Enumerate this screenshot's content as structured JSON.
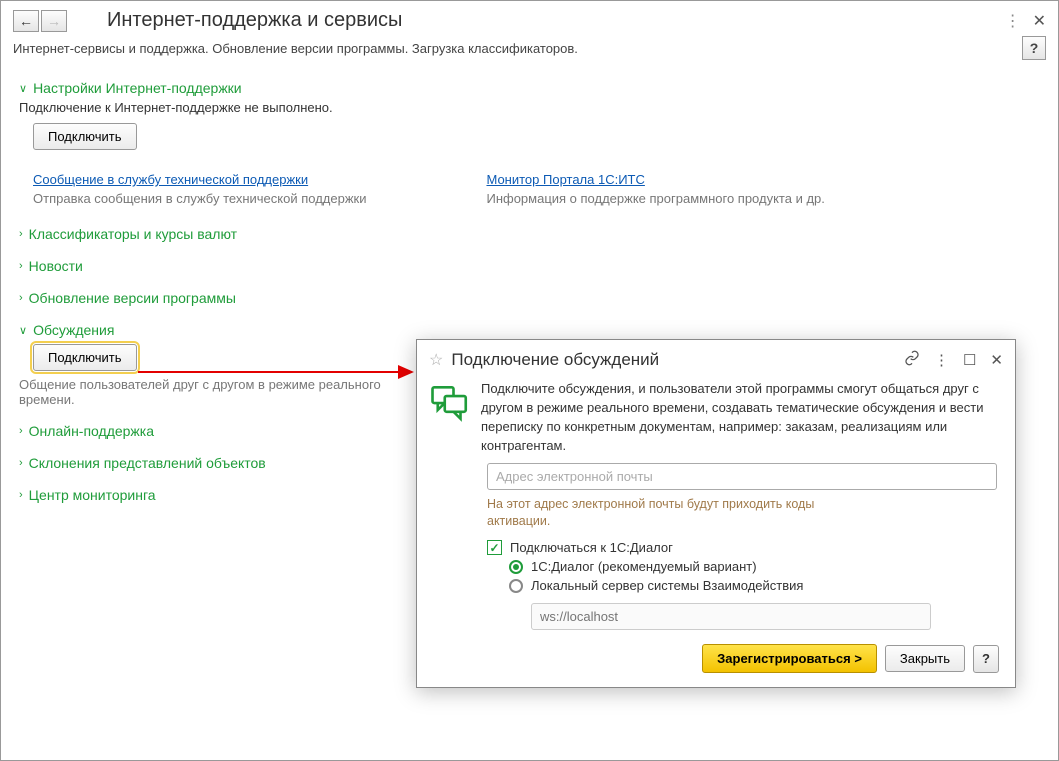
{
  "header": {
    "title": "Интернет-поддержка и сервисы",
    "subtitle": "Интернет-сервисы и поддержка. Обновление версии программы. Загрузка классификаторов."
  },
  "sections": {
    "internet_support": {
      "title": "Настройки Интернет-поддержки",
      "status": "Подключение к Интернет-поддержке не выполнено.",
      "connect_label": "Подключить"
    },
    "links": {
      "support_msg": "Сообщение в службу технической поддержки",
      "support_desc": "Отправка сообщения в службу технической поддержки",
      "monitor": "Монитор Портала 1С:ИТС",
      "monitor_desc": "Информация о поддержке программного продукта и др."
    },
    "classifiers": "Классификаторы и курсы валют",
    "news": "Новости",
    "update": "Обновление версии программы",
    "discussions": {
      "title": "Обсуждения",
      "connect_label": "Подключить",
      "desc": "Общение пользователей друг с другом в режиме реального времени."
    },
    "online_support": "Онлайн-поддержка",
    "declensions": "Склонения представлений объектов",
    "monitoring": "Центр мониторинга"
  },
  "dialog": {
    "title": "Подключение обсуждений",
    "body": "Подключите обсуждения, и пользователи этой программы смогут общаться друг с другом в режиме реального времени, создавать тематические обсуждения и вести переписку по конкретным документам, например: заказам, реализациям или контрагентам.",
    "email_placeholder": "Адрес электронной почты",
    "hint": "На этот адрес электронной почты будут приходить коды активации.",
    "checkbox": "Подключаться к 1С:Диалог",
    "radio1": "1С:Диалог (рекомендуемый вариант)",
    "radio2": "Локальный сервер системы Взаимодействия",
    "local_placeholder": "ws://localhost",
    "register": "Зарегистрироваться >",
    "close": "Закрыть"
  }
}
